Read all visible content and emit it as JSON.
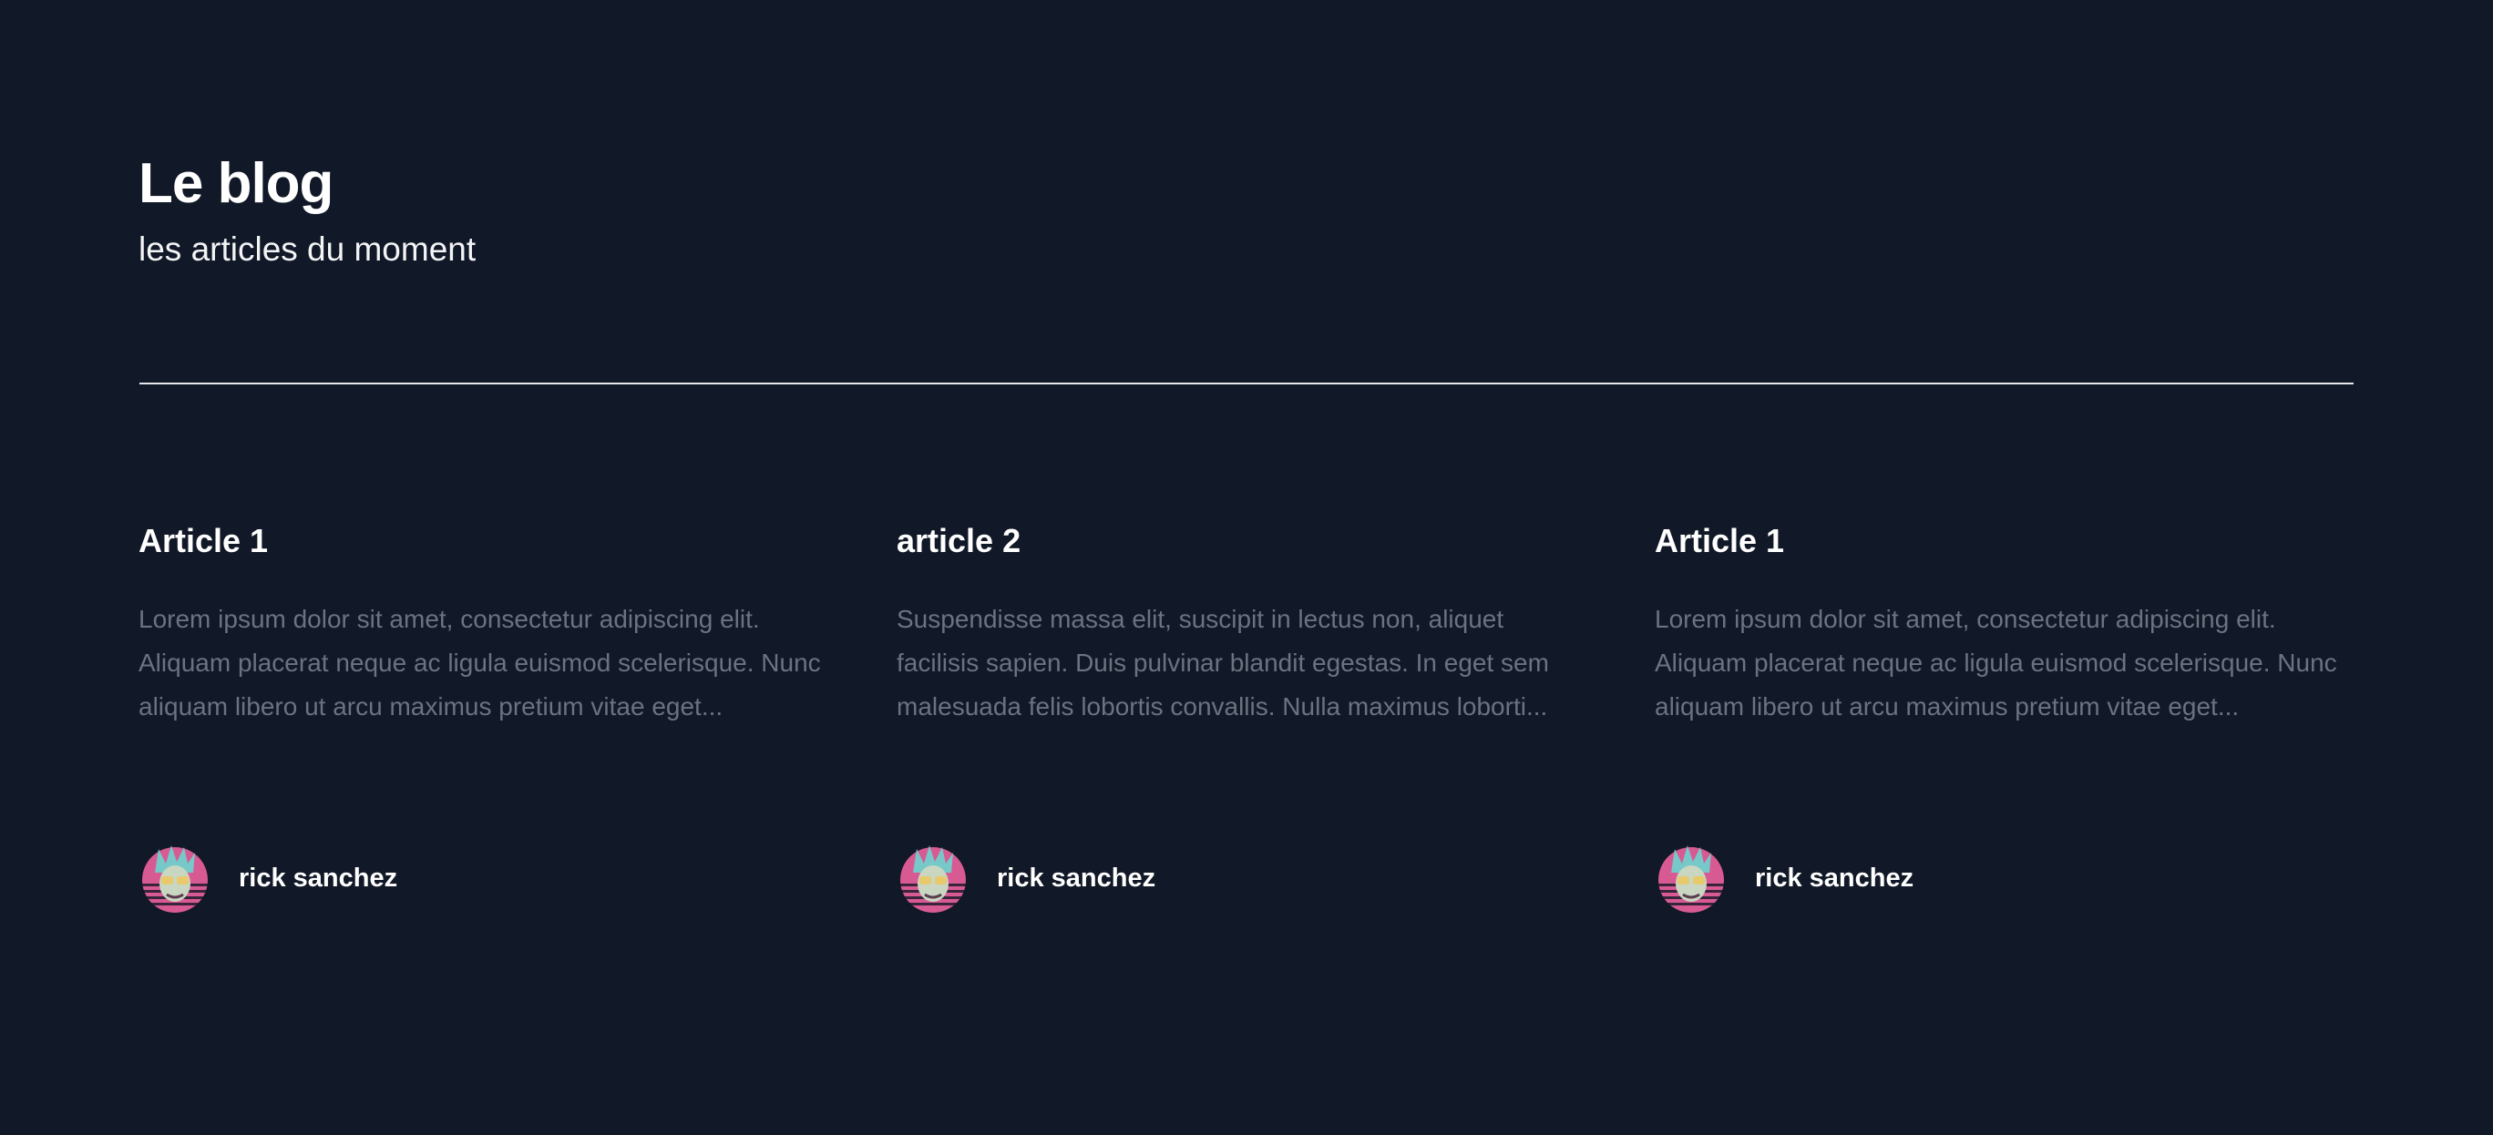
{
  "header": {
    "title": "Le blog",
    "subtitle": "les articles du moment"
  },
  "articles": [
    {
      "title": "Article 1",
      "excerpt": "Lorem ipsum dolor sit amet, consectetur adipiscing elit. Aliquam placerat neque ac ligula euismod scelerisque. Nunc aliquam libero ut arcu maximus pretium vitae eget...",
      "author": "rick sanchez"
    },
    {
      "title": "article 2",
      "excerpt": "Suspendisse massa elit, suscipit in lectus non, aliquet facilisis sapien. Duis pulvinar blandit egestas. In eget sem malesuada felis lobortis convallis. Nulla maximus loborti...",
      "author": "rick sanchez"
    },
    {
      "title": "Article 1",
      "excerpt": "Lorem ipsum dolor sit amet, consectetur adipiscing elit. Aliquam placerat neque ac ligula euismod scelerisque. Nunc aliquam libero ut arcu maximus pretium vitae eget...",
      "author": "rick sanchez"
    }
  ],
  "icons": {
    "avatar": "rick-sanchez-avatar-icon"
  },
  "colors": {
    "background": "#111827",
    "title": "#ffffff",
    "excerpt": "#6b7280",
    "divider": "#e5e7eb",
    "avatar_accent": "#e0629a"
  }
}
